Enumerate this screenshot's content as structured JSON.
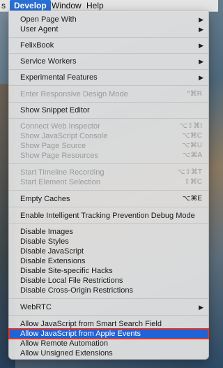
{
  "menubar": {
    "items": [
      {
        "label": "s"
      },
      {
        "label": "Develop"
      },
      {
        "label": "Window"
      },
      {
        "label": "Help"
      }
    ]
  },
  "menu": {
    "submenu_arrow": "▶",
    "items": [
      {
        "label": "Open Page With",
        "shortcut": ""
      },
      {
        "label": "User Agent",
        "shortcut": ""
      },
      {
        "label": "FelixBook",
        "shortcut": ""
      },
      {
        "label": "Service Workers",
        "shortcut": ""
      },
      {
        "label": "Experimental Features",
        "shortcut": ""
      },
      {
        "label": "Enter Responsive Design Mode",
        "shortcut": "^⌘R"
      },
      {
        "label": "Show Snippet Editor",
        "shortcut": ""
      },
      {
        "label": "Connect Web Inspector",
        "shortcut": "⌥⇧⌘I"
      },
      {
        "label": "Show JavaScript Console",
        "shortcut": "⌥⌘C"
      },
      {
        "label": "Show Page Source",
        "shortcut": "⌥⌘U"
      },
      {
        "label": "Show Page Resources",
        "shortcut": "⌥⌘A"
      },
      {
        "label": "Start Timeline Recording",
        "shortcut": "⌥⇧⌘T"
      },
      {
        "label": "Start Element Selection",
        "shortcut": "⇧⌘C"
      },
      {
        "label": "Empty Caches",
        "shortcut": "⌥⌘E"
      },
      {
        "label": "Enable Intelligent Tracking Prevention Debug Mode",
        "shortcut": ""
      },
      {
        "label": "Disable Images",
        "shortcut": ""
      },
      {
        "label": "Disable Styles",
        "shortcut": ""
      },
      {
        "label": "Disable JavaScript",
        "shortcut": ""
      },
      {
        "label": "Disable Extensions",
        "shortcut": ""
      },
      {
        "label": "Disable Site-specific Hacks",
        "shortcut": ""
      },
      {
        "label": "Disable Local File Restrictions",
        "shortcut": ""
      },
      {
        "label": "Disable Cross-Origin Restrictions",
        "shortcut": ""
      },
      {
        "label": "WebRTC",
        "shortcut": ""
      },
      {
        "label": "Allow JavaScript from Smart Search Field",
        "shortcut": ""
      },
      {
        "label": "Allow JavaScript from Apple Events",
        "shortcut": ""
      },
      {
        "label": "Allow Remote Automation",
        "shortcut": ""
      },
      {
        "label": "Allow Unsigned Extensions",
        "shortcut": ""
      }
    ]
  },
  "colors": {
    "selection": "#1f63d6",
    "highlight_border": "#e0352b",
    "menubar_active": "#2a6fd6"
  }
}
